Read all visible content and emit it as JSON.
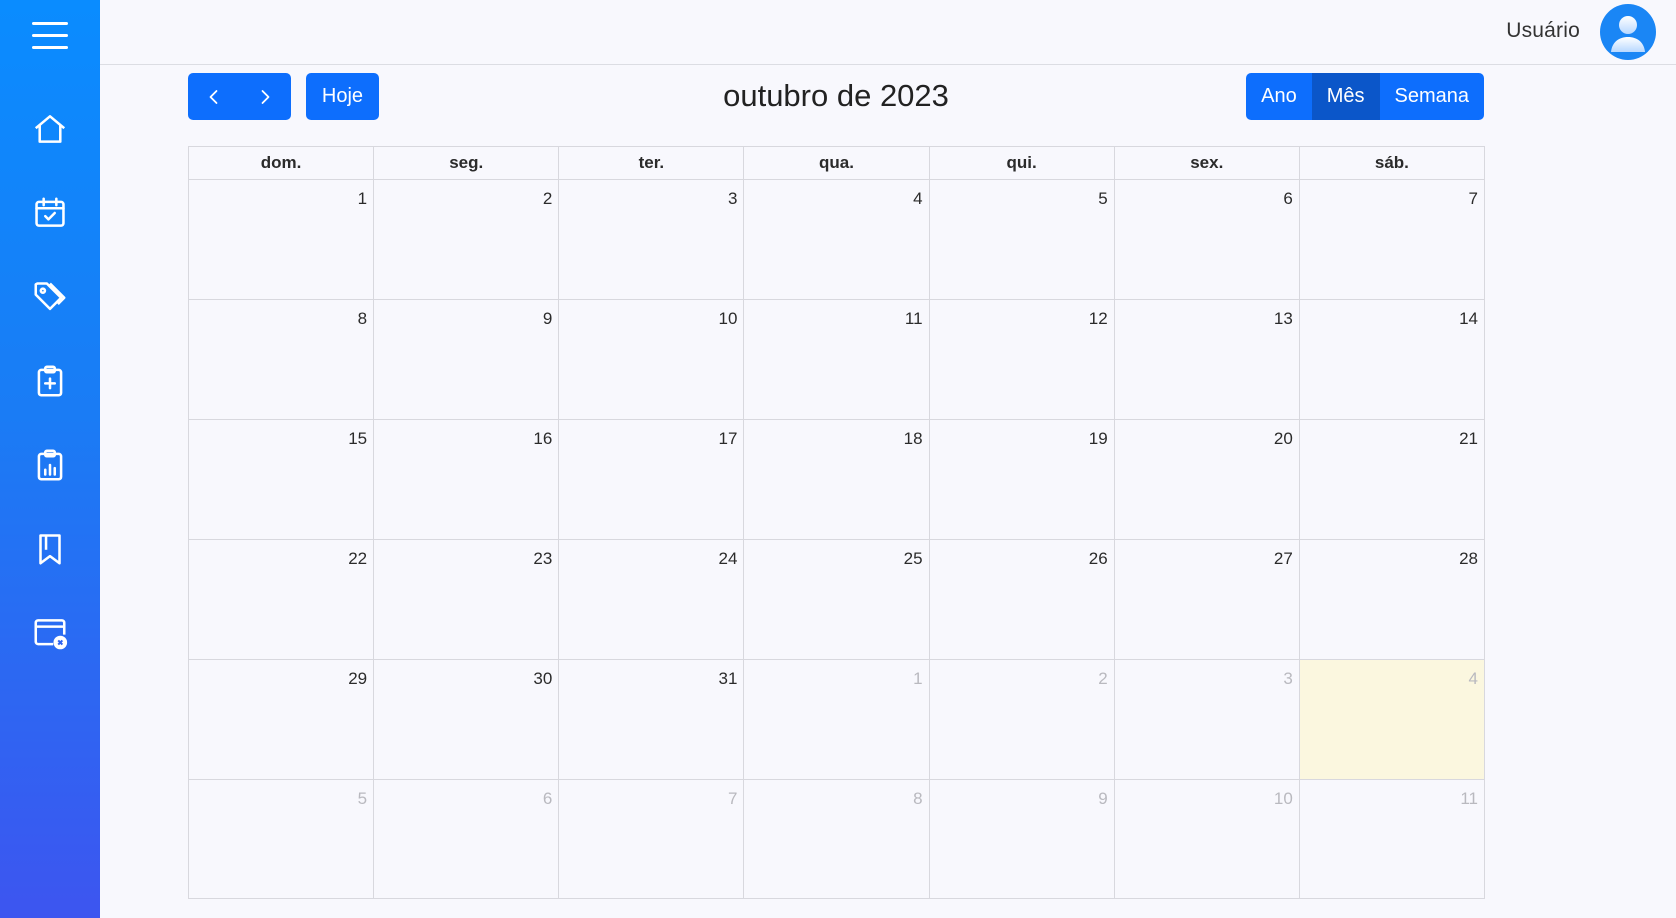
{
  "sidebar": {
    "items": [
      {
        "icon": "home-icon"
      },
      {
        "icon": "calendar-check-icon"
      },
      {
        "icon": "tags-icon"
      },
      {
        "icon": "clipboard-plus-icon"
      },
      {
        "icon": "clipboard-chart-icon"
      },
      {
        "icon": "bookmark-icon"
      },
      {
        "icon": "window-close-icon"
      }
    ]
  },
  "header": {
    "user_name": "Usuário"
  },
  "calendar": {
    "title": "outubro de 2023",
    "today_label": "Hoje",
    "views": [
      "Ano",
      "Mês",
      "Semana"
    ],
    "active_view": "Mês",
    "weekdays": [
      "dom.",
      "seg.",
      "ter.",
      "qua.",
      "qui.",
      "sex.",
      "sáb."
    ],
    "weeks": [
      [
        {
          "d": "1"
        },
        {
          "d": "2"
        },
        {
          "d": "3"
        },
        {
          "d": "4"
        },
        {
          "d": "5"
        },
        {
          "d": "6"
        },
        {
          "d": "7"
        }
      ],
      [
        {
          "d": "8"
        },
        {
          "d": "9"
        },
        {
          "d": "10"
        },
        {
          "d": "11"
        },
        {
          "d": "12"
        },
        {
          "d": "13"
        },
        {
          "d": "14"
        }
      ],
      [
        {
          "d": "15"
        },
        {
          "d": "16"
        },
        {
          "d": "17"
        },
        {
          "d": "18"
        },
        {
          "d": "19"
        },
        {
          "d": "20"
        },
        {
          "d": "21"
        }
      ],
      [
        {
          "d": "22"
        },
        {
          "d": "23"
        },
        {
          "d": "24"
        },
        {
          "d": "25"
        },
        {
          "d": "26"
        },
        {
          "d": "27"
        },
        {
          "d": "28"
        }
      ],
      [
        {
          "d": "29"
        },
        {
          "d": "30"
        },
        {
          "d": "31"
        },
        {
          "d": "1",
          "other": true
        },
        {
          "d": "2",
          "other": true
        },
        {
          "d": "3",
          "other": true
        },
        {
          "d": "4",
          "other": true,
          "today": true
        }
      ],
      [
        {
          "d": "5",
          "other": true
        },
        {
          "d": "6",
          "other": true
        },
        {
          "d": "7",
          "other": true
        },
        {
          "d": "8",
          "other": true
        },
        {
          "d": "9",
          "other": true
        },
        {
          "d": "10",
          "other": true
        },
        {
          "d": "11",
          "other": true
        }
      ]
    ]
  },
  "colors": {
    "primary": "#0d6efd",
    "primary_active": "#0b56c9",
    "today_highlight": "#fbf7df",
    "sidebar_top": "#0a8cff",
    "sidebar_bottom": "#3d55f0"
  }
}
